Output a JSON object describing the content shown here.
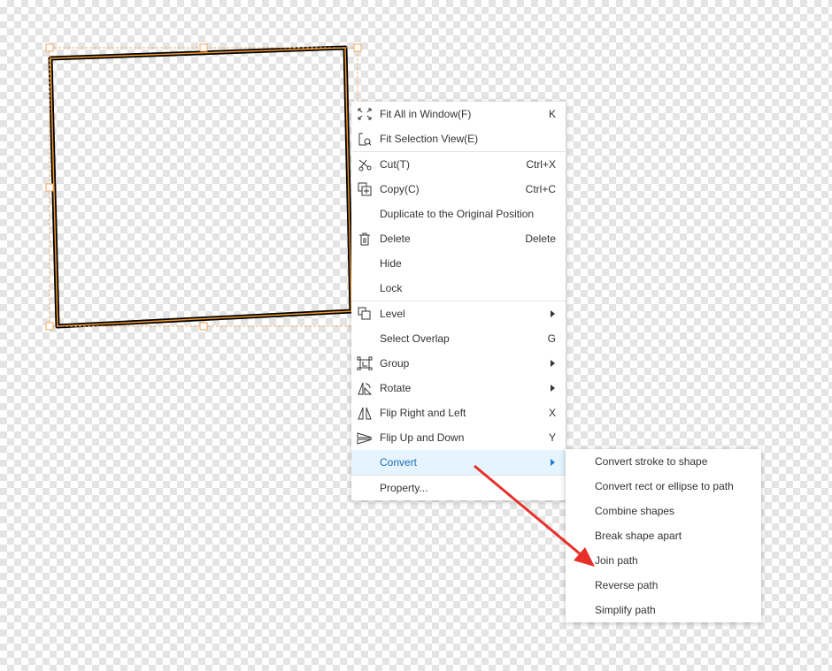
{
  "context_menu": {
    "groups": [
      [
        {
          "icon": "fit-window-icon",
          "label": "Fit All in Window(F)",
          "shortcut": "K"
        },
        {
          "icon": "fit-selection-icon",
          "label": "Fit Selection View(E)",
          "shortcut": ""
        }
      ],
      [
        {
          "icon": "scissors-icon",
          "label": "Cut(T)",
          "shortcut": "Ctrl+X"
        },
        {
          "icon": "copy-icon",
          "label": "Copy(C)",
          "shortcut": "Ctrl+C"
        },
        {
          "icon": "",
          "label": "Duplicate to the Original Position",
          "shortcut": ""
        },
        {
          "icon": "trash-icon",
          "label": "Delete",
          "shortcut": "Delete"
        },
        {
          "icon": "",
          "label": "Hide",
          "shortcut": ""
        },
        {
          "icon": "",
          "label": "Lock",
          "shortcut": ""
        }
      ],
      [
        {
          "icon": "level-icon",
          "label": "Level",
          "submenu": true
        },
        {
          "icon": "",
          "label": "Select Overlap",
          "shortcut": "G"
        },
        {
          "icon": "group-icon",
          "label": "Group",
          "submenu": true
        },
        {
          "icon": "rotate-icon",
          "label": "Rotate",
          "submenu": true
        },
        {
          "icon": "flip-horizontal-icon",
          "label": "Flip Right and Left",
          "shortcut": "X"
        },
        {
          "icon": "flip-vertical-icon",
          "label": "Flip Up and Down",
          "shortcut": "Y"
        },
        {
          "icon": "",
          "label": "Convert",
          "submenu": true,
          "active": true
        }
      ],
      [
        {
          "icon": "",
          "label": "Property...",
          "shortcut": ""
        }
      ]
    ]
  },
  "convert_submenu": {
    "items": [
      "Convert stroke to shape",
      "Convert rect or ellipse to path",
      "Combine shapes",
      "Break shape apart",
      "Join path",
      "Reverse path",
      "Simplify path"
    ]
  },
  "colors": {
    "shape_stroke": "#000000",
    "shape_inner_stroke": "#f0962e",
    "selection": "#f5b070",
    "active_item_bg": "#e5f4fe",
    "active_item_text": "#1f6fb5",
    "annotation_arrow": "#e8302a"
  }
}
